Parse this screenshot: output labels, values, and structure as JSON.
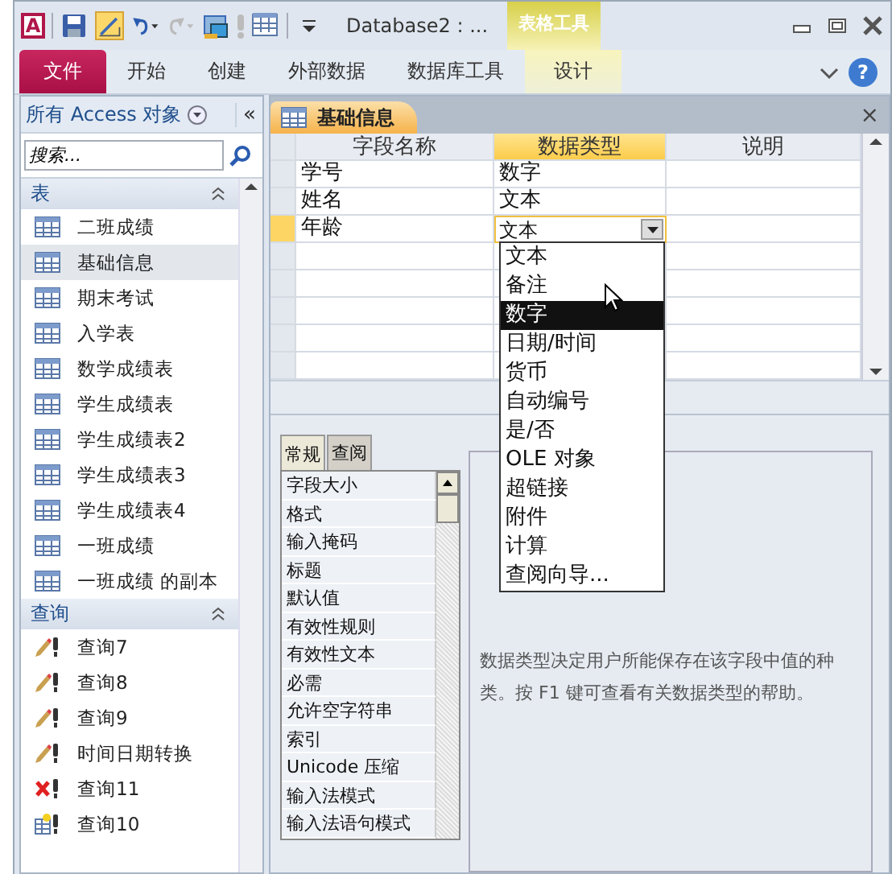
{
  "title_bar": {
    "logo_text": "A",
    "title": "Database2 : ...",
    "context_label": "表格工具"
  },
  "ribbon": {
    "tabs": [
      {
        "label": "文件",
        "kind": "file"
      },
      {
        "label": "开始",
        "kind": "normal"
      },
      {
        "label": "创建",
        "kind": "normal"
      },
      {
        "label": "外部数据",
        "kind": "normal"
      },
      {
        "label": "数据库工具",
        "kind": "normal"
      },
      {
        "label": "设计",
        "kind": "contextual"
      }
    ],
    "help_label": "?"
  },
  "nav_pane": {
    "header": "所有 Access 对象",
    "collapse_label": "«",
    "search": {
      "placeholder": "搜索..."
    },
    "groups": [
      {
        "title": "表",
        "items": [
          {
            "label": "二班成绩",
            "kind": "table",
            "selected": false
          },
          {
            "label": "基础信息",
            "kind": "table",
            "selected": true
          },
          {
            "label": "期末考试",
            "kind": "table",
            "selected": false
          },
          {
            "label": "入学表",
            "kind": "table",
            "selected": false
          },
          {
            "label": "数学成绩表",
            "kind": "table",
            "selected": false
          },
          {
            "label": "学生成绩表",
            "kind": "table",
            "selected": false
          },
          {
            "label": "学生成绩表2",
            "kind": "table",
            "selected": false
          },
          {
            "label": "学生成绩表3",
            "kind": "table",
            "selected": false
          },
          {
            "label": "学生成绩表4",
            "kind": "table",
            "selected": false
          },
          {
            "label": "一班成绩",
            "kind": "table",
            "selected": false
          },
          {
            "label": "一班成绩 的副本",
            "kind": "table",
            "selected": false
          }
        ]
      },
      {
        "title": "查询",
        "items": [
          {
            "label": "查询7",
            "kind": "update-query",
            "selected": false
          },
          {
            "label": "查询8",
            "kind": "update-query",
            "selected": false
          },
          {
            "label": "查询9",
            "kind": "update-query",
            "selected": false
          },
          {
            "label": "时间日期转换",
            "kind": "update-query",
            "selected": false
          },
          {
            "label": "查询11",
            "kind": "delete-query",
            "selected": false
          },
          {
            "label": "查询10",
            "kind": "make-table-query",
            "selected": false
          }
        ]
      }
    ]
  },
  "document": {
    "tab": {
      "label": "基础信息",
      "close_label": "×"
    },
    "columns": [
      {
        "label": "字段名称",
        "selected": false
      },
      {
        "label": "数据类型",
        "selected": true
      },
      {
        "label": "说明",
        "selected": false
      }
    ],
    "rows": [
      {
        "field": "学号",
        "type": "数字",
        "selected": false
      },
      {
        "field": "姓名",
        "type": "文本",
        "selected": false
      },
      {
        "field": "年龄",
        "type": "文本",
        "selected": true
      }
    ],
    "type_dropdown": {
      "options": [
        {
          "label": "文本",
          "selected": false
        },
        {
          "label": "备注",
          "selected": false
        },
        {
          "label": "数字",
          "selected": true
        },
        {
          "label": "日期/时间",
          "selected": false
        },
        {
          "label": "货币",
          "selected": false
        },
        {
          "label": "自动编号",
          "selected": false
        },
        {
          "label": "是/否",
          "selected": false
        },
        {
          "label": "OLE 对象",
          "selected": false
        },
        {
          "label": "超链接",
          "selected": false
        },
        {
          "label": "附件",
          "selected": false
        },
        {
          "label": "计算",
          "selected": false
        },
        {
          "label": "查阅向导...",
          "selected": false
        }
      ]
    }
  },
  "properties": {
    "tabs": [
      {
        "label": "常规",
        "selected": true
      },
      {
        "label": "查阅",
        "selected": false
      }
    ],
    "items": [
      "字段大小",
      "格式",
      "输入掩码",
      "标题",
      "默认值",
      "有效性规则",
      "有效性文本",
      "必需",
      "允许空字符串",
      "索引",
      "Unicode 压缩",
      "输入法模式",
      "输入法语句模式"
    ],
    "help": "数据类型决定用户所能保存在该字段中值的种类。按 F1 键可查看有关数据类型的帮助。"
  }
}
